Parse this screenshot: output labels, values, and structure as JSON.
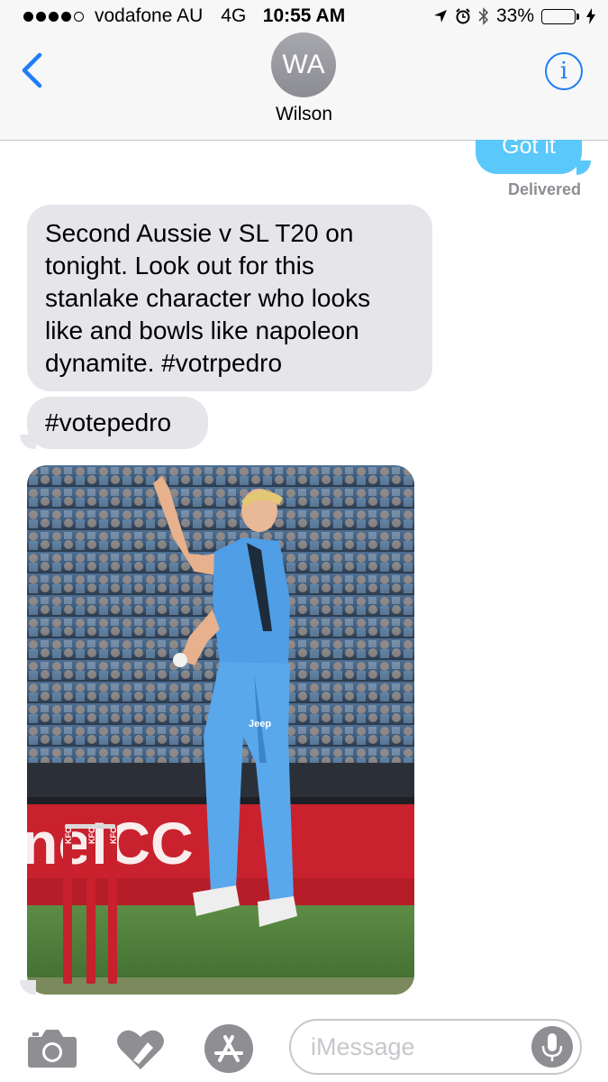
{
  "status_bar": {
    "carrier": "vodafone AU",
    "network": "4G",
    "time": "10:55 AM",
    "battery_percent": "33%",
    "battery_level": 0.33,
    "signal_bars": 4
  },
  "header": {
    "avatar_initials": "WA",
    "contact_name": "Wilson"
  },
  "messages": {
    "sent": [
      {
        "text": "Got it",
        "status": "Delivered"
      }
    ],
    "received": [
      {
        "text": "Second Aussie v SL T20 on tonight. Look out for this stanlake character who looks like and bowls like napoleon dynamite. #votrpedro"
      },
      {
        "text": "#votepedro"
      }
    ],
    "photo": {
      "ad_text": "neICC",
      "stump_text": "KFC",
      "shirt_text": "Jeep"
    }
  },
  "composer": {
    "placeholder": "iMessage"
  },
  "icons": {
    "back": "chevron-left-icon",
    "info": "info-icon",
    "camera": "camera-icon",
    "digital_touch": "heart-icon",
    "app_store": "app-store-icon",
    "mic": "microphone-icon"
  },
  "colors": {
    "accent": "#1f7ef7",
    "sent_bubble": "#5ac8fa",
    "received_bubble": "#e5e5ea",
    "battery": "#4cd964"
  }
}
